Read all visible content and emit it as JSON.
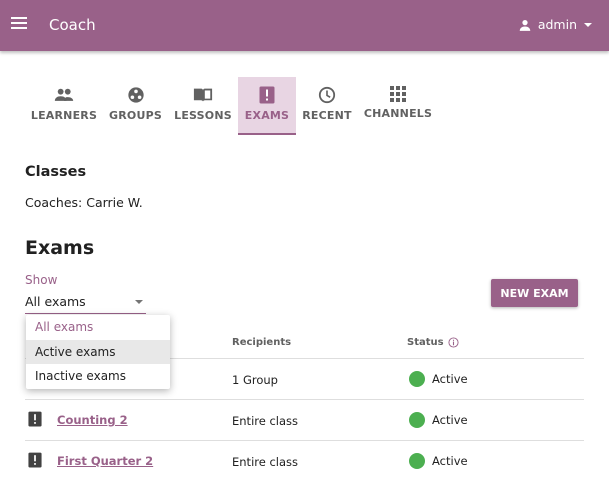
{
  "appbar": {
    "title": "Coach",
    "user": "admin"
  },
  "tabs": [
    {
      "label": "LEARNERS",
      "icon": "people-icon",
      "active": false
    },
    {
      "label": "GROUPS",
      "icon": "groups-icon",
      "active": false
    },
    {
      "label": "LESSONS",
      "icon": "book-icon",
      "active": false
    },
    {
      "label": "EXAMS",
      "icon": "exam-icon",
      "active": true
    },
    {
      "label": "RECENT",
      "icon": "clock-icon",
      "active": false
    },
    {
      "label": "CHANNELS",
      "icon": "grid-icon",
      "active": false
    }
  ],
  "classes": {
    "heading": "Classes",
    "coaches": "Coaches: Carrie W."
  },
  "exams": {
    "heading": "Exams",
    "show_label": "Show",
    "filter_value": "All exams",
    "filter_options": [
      "All exams",
      "Active exams",
      "Inactive exams"
    ],
    "new_exam_label": "NEW EXAM",
    "columns": {
      "recipients": "Recipients",
      "status": "Status"
    },
    "rows": [
      {
        "title": "",
        "recipients": "1 Group",
        "status": "Active"
      },
      {
        "title": "Counting 2",
        "recipients": "Entire class",
        "status": "Active"
      },
      {
        "title": "First Quarter 2",
        "recipients": "Entire class",
        "status": "Active"
      }
    ]
  },
  "colors": {
    "brand": "#996189",
    "brand_light": "#e8d5e3",
    "status_active": "#4caf50"
  }
}
